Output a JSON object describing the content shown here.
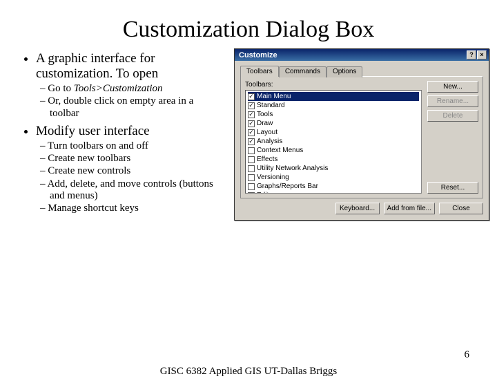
{
  "title": "Customization Dialog Box",
  "bullets": {
    "b1": "A graphic interface for customization. To open",
    "b1s": [
      "Go to ",
      "Tools>Customization",
      "Or, double click on empty area in a toolbar"
    ],
    "b2": "Modify user interface",
    "b2s": [
      "Turn toolbars on and off",
      "Create new toolbars",
      "Create new controls",
      "Add, delete, and move controls (buttons and menus)",
      "Manage shortcut keys"
    ]
  },
  "dialog": {
    "title": "Customize",
    "help": "?",
    "close": "×",
    "tabs": {
      "t1": "Toolbars",
      "t2": "Commands",
      "t3": "Options"
    },
    "listLabel": "Toolbars:",
    "items": [
      {
        "label": "Main Menu",
        "checked": true,
        "selected": true
      },
      {
        "label": "Standard",
        "checked": true
      },
      {
        "label": "Tools",
        "checked": true
      },
      {
        "label": "Draw",
        "checked": true
      },
      {
        "label": "Layout",
        "checked": true
      },
      {
        "label": "Analysis",
        "checked": true
      },
      {
        "label": "Context Menus",
        "checked": false
      },
      {
        "label": "Effects",
        "checked": false
      },
      {
        "label": "Utility Network Analysis",
        "checked": false
      },
      {
        "label": "Versioning",
        "checked": false
      },
      {
        "label": "Graphs/Reports Bar",
        "checked": false
      },
      {
        "label": "Editor",
        "checked": false
      }
    ],
    "btns": {
      "new": "New...",
      "rename": "Rename...",
      "delete": "Delete",
      "reset": "Reset...",
      "keyboard": "Keyboard...",
      "addfile": "Add from file...",
      "closeBtn": "Close"
    }
  },
  "footer": "GISC 6382   Applied GIS   UT-Dallas  Briggs",
  "page": "6"
}
